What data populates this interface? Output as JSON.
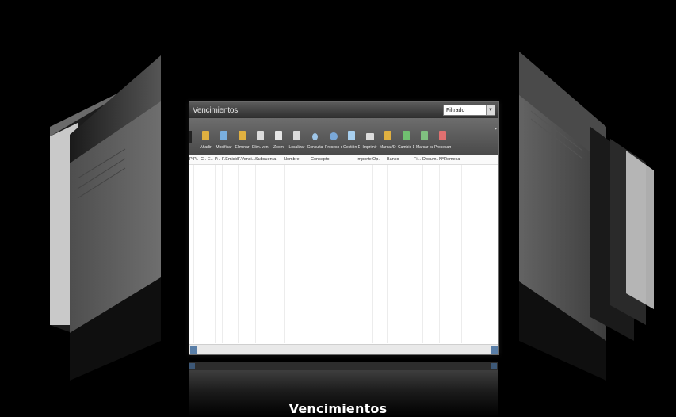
{
  "window": {
    "title": "Vencimientos",
    "filter_value": "Filtrado"
  },
  "toolbar": {
    "buttons": [
      {
        "label": "Añadir",
        "icon": "add-doc-icon",
        "color": "#e0b040"
      },
      {
        "label": "Modificar",
        "icon": "edit-doc-icon",
        "color": "#7ab0e0"
      },
      {
        "label": "Eliminar",
        "icon": "delete-doc-icon",
        "color": "#e0b040"
      },
      {
        "label": "Elim. ven...",
        "icon": "delete-due-icon",
        "color": "#dcdcdc"
      },
      {
        "label": "Zoom",
        "icon": "zoom-icon",
        "color": "#e6e6e6"
      },
      {
        "label": "Localizar",
        "icon": "locate-icon",
        "color": "#dcdcdc"
      },
      {
        "label": "Consulta",
        "icon": "query-icon",
        "color": "#9fc6e8"
      },
      {
        "label": "Proceso d...",
        "icon": "process-icon",
        "color": "#7aa8d8"
      },
      {
        "label": "Gestión D...",
        "icon": "management-icon",
        "color": "#a8d0f0"
      },
      {
        "label": "Imprimir",
        "icon": "print-icon",
        "color": "#dcdcdc"
      },
      {
        "label": "Marcar/D...",
        "icon": "mark-icon",
        "color": "#e0b040"
      },
      {
        "label": "Cambio E...",
        "icon": "change-status-icon",
        "color": "#70c070"
      },
      {
        "label": "Marcar pa...",
        "icon": "mark-paid-icon",
        "color": "#80c080"
      },
      {
        "label": "Procesam...",
        "icon": "processing-icon",
        "color": "#e07070"
      }
    ]
  },
  "grid": {
    "columns": [
      "P",
      "P..",
      "C..",
      "E..",
      "P..",
      "F.Emisión",
      "F.Venci...",
      "Subcuenta",
      "Nombre",
      "Concepto",
      "Importe",
      "Op.",
      "Banco",
      "Fi...",
      "Docum...",
      "NºRemesa"
    ]
  },
  "caption": "Vencimientos"
}
